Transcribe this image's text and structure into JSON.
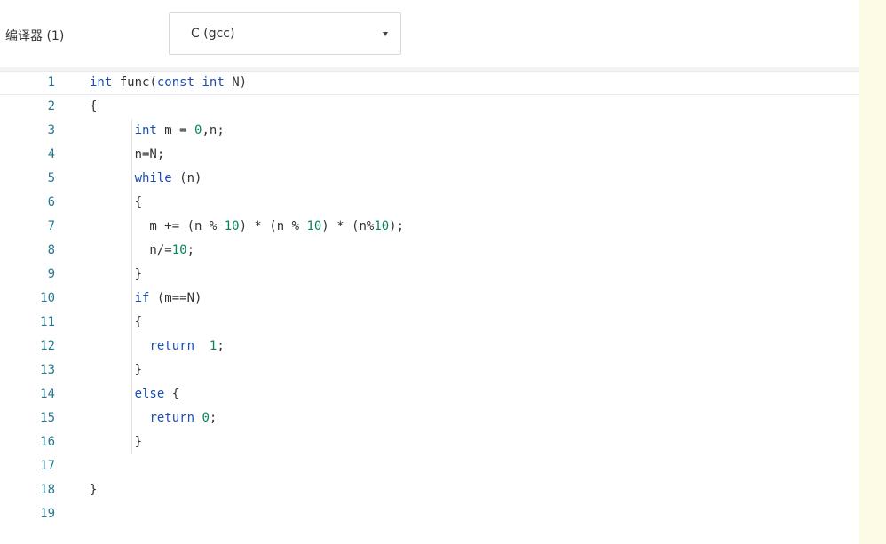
{
  "compiler": {
    "label": "编译器 (1)",
    "selected": "C (gcc)"
  },
  "editor": {
    "lines": [
      {
        "n": "1",
        "code": "int func(const int N)"
      },
      {
        "n": "2",
        "code": "{"
      },
      {
        "n": "3",
        "code": "      int m = 0,n;"
      },
      {
        "n": "4",
        "code": "      n=N;"
      },
      {
        "n": "5",
        "code": "      while (n)"
      },
      {
        "n": "6",
        "code": "      {"
      },
      {
        "n": "7",
        "code": "        m += (n % 10) * (n % 10) * (n%10);"
      },
      {
        "n": "8",
        "code": "        n/=10;"
      },
      {
        "n": "9",
        "code": "      }"
      },
      {
        "n": "10",
        "code": "      if (m==N)"
      },
      {
        "n": "11",
        "code": "      {"
      },
      {
        "n": "12",
        "code": "        return  1;"
      },
      {
        "n": "13",
        "code": "      }"
      },
      {
        "n": "14",
        "code": "      else {"
      },
      {
        "n": "15",
        "code": "        return 0;"
      },
      {
        "n": "16",
        "code": "      }"
      },
      {
        "n": "17",
        "code": ""
      },
      {
        "n": "18",
        "code": "}"
      },
      {
        "n": "19",
        "code": ""
      }
    ]
  },
  "colors": {
    "keyword": "#1a4eb5",
    "number": "#098658",
    "line_number": "#237893",
    "side_panel": "#fdfbe6"
  }
}
